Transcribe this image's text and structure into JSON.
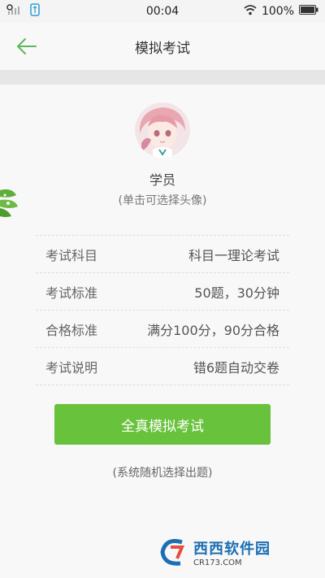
{
  "status_bar": {
    "time": "00:04",
    "battery": "100%"
  },
  "header": {
    "title": "模拟考试"
  },
  "profile": {
    "name": "学员",
    "hint": "(单击可选择头像)"
  },
  "info": [
    {
      "label": "考试科目",
      "value": "科目一理论考试"
    },
    {
      "label": "考试标准",
      "value": "50题，30分钟"
    },
    {
      "label": "合格标准",
      "value": "满分100分，90分合格"
    },
    {
      "label": "考试说明",
      "value": "错6题自动交卷"
    }
  ],
  "start_button": {
    "label": "全真模拟考试"
  },
  "footnote": "(系统随机选择出题)",
  "watermark": {
    "title": "西西软件园",
    "sub": "CR173.COM"
  },
  "colors": {
    "accent": "#69c23c",
    "back_arrow": "#5cb85c"
  }
}
